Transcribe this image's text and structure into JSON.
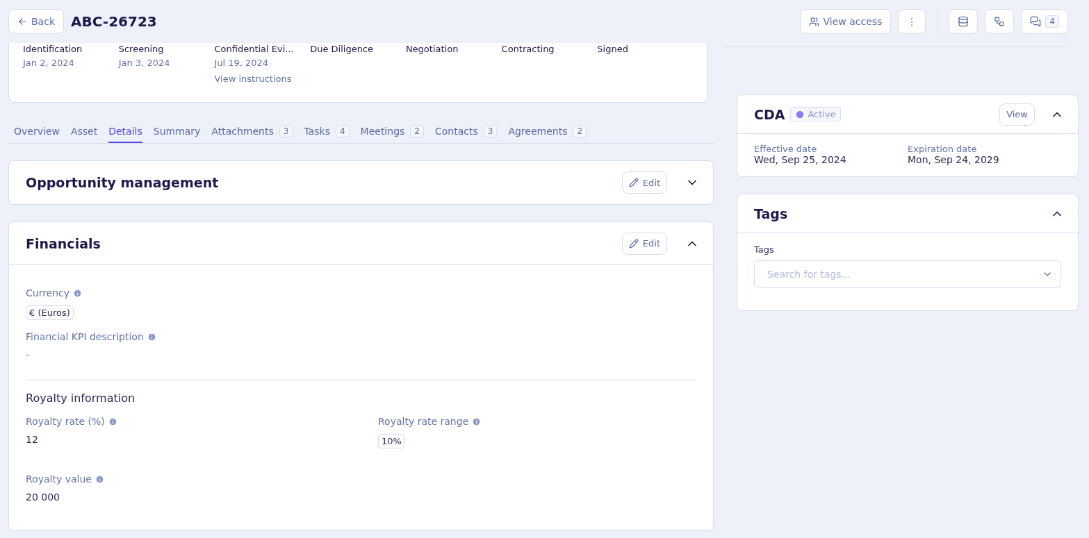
{
  "header": {
    "back": "Back",
    "title": "ABC-26723",
    "view_access": "View access",
    "more": "⋮",
    "comments_count": "4"
  },
  "stages": [
    {
      "name": "Identification",
      "date": "Jan 2, 2024"
    },
    {
      "name": "Screening",
      "date": "Jan 3, 2024"
    },
    {
      "name": "Confidential Evi...",
      "date": "Jul 19, 2024",
      "link": "View instructions"
    },
    {
      "name": "Due Diligence"
    },
    {
      "name": "Negotiation"
    },
    {
      "name": "Contracting"
    },
    {
      "name": "Signed"
    }
  ],
  "tabs": [
    {
      "label": "Overview",
      "selected": false
    },
    {
      "label": "Asset",
      "selected": false
    },
    {
      "label": "Details",
      "selected": true
    },
    {
      "label": "Summary",
      "selected": false
    },
    {
      "label": "Attachments",
      "count": "3",
      "selected": false
    },
    {
      "label": "Tasks",
      "count": "4",
      "selected": false
    },
    {
      "label": "Meetings",
      "count": "2",
      "selected": false
    },
    {
      "label": "Contacts",
      "count": "3",
      "selected": false
    },
    {
      "label": "Agreements",
      "count": "2",
      "selected": false
    }
  ],
  "sections": [
    {
      "title": "Opportunity management",
      "edit": "Edit",
      "expanded": false
    },
    {
      "title": "Financials",
      "edit": "Edit",
      "expanded": true,
      "fields": [
        {
          "label": "Currency",
          "value": "€ (Euros)",
          "kind": "tag"
        },
        {
          "label": "Financial KPI description",
          "value": "-",
          "kind": "empty"
        }
      ],
      "subsection": {
        "title": "Royalty information",
        "fields": [
          {
            "label": "Royalty rate (%)",
            "value": "12",
            "kind": "text"
          },
          {
            "label": "Royalty rate range",
            "value": "10%",
            "kind": "tag"
          },
          {
            "label": "Royalty value",
            "value": "20 000",
            "kind": "text"
          }
        ]
      }
    }
  ],
  "cda": {
    "title": "CDA",
    "status": "Active",
    "view": "View",
    "expanded": true,
    "dates": [
      {
        "label": "Effective date",
        "value": "Wed, Sep 25, 2024"
      },
      {
        "label": "Expiration date",
        "value": "Mon, Sep 24, 2029"
      }
    ]
  },
  "tags": {
    "title": "Tags",
    "expanded": true,
    "label": "Tags",
    "placeholder": "Search for tags..."
  }
}
